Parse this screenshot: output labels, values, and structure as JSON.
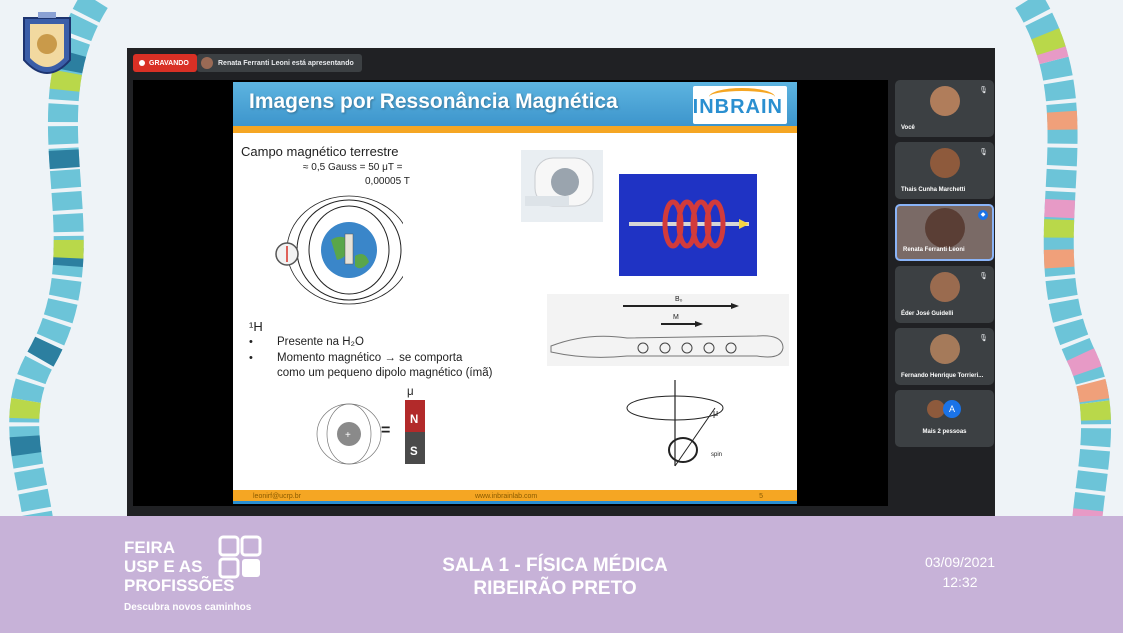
{
  "meeting": {
    "recording_label": "GRAVANDO",
    "presenting_text": "Renata Ferranti Leoni está apresentando"
  },
  "slide": {
    "title": "Imagens por Ressonância Magnética",
    "logo": "INBRAIN",
    "campo_title": "Campo magnético terrestre",
    "campo_value_1": "≈ 0,5 Gauss = 50 μT =",
    "campo_value_2": "0,00005 T",
    "h_label": "¹H",
    "bullet_1": "Presente na H₂O",
    "bullet_2_line1": "Momento magnético  →  se  comporta",
    "bullet_2_line2": "como um pequeno dipolo magnético (ímã)",
    "equals": "=",
    "magnet_n": "N",
    "magnet_s": "S",
    "mu": "μ",
    "b0": "B₀",
    "m": "M",
    "spin": "spin",
    "footer_email": "leonirf@ucrp.br",
    "footer_site": "www.inbrainlab.com",
    "page_number": "5"
  },
  "participants": [
    {
      "name": "Você"
    },
    {
      "name": "Thais Cunha Marchetti"
    },
    {
      "name": "Renata Ferranti Leoni"
    },
    {
      "name": "Éder José Guidelli"
    },
    {
      "name": "Fernando Henrique Torrieri..."
    }
  ],
  "more_people": "Mais 2 pessoas",
  "more_avatar_letter": "A",
  "banner": {
    "feira_line1": "FEIRA",
    "feira_line2": "USP E AS",
    "feira_line3": "PROFISSÕES",
    "tagline": "Descubra novos caminhos",
    "room_line1": "SALA 1 - FÍSICA MÉDICA",
    "room_line2": "RIBEIRÃO PRETO",
    "date": "03/09/2021",
    "time": "12:32"
  },
  "colors": {
    "banner": "#c7b2d8",
    "slide_header": "#3d95cc",
    "slide_accent": "#f5a623",
    "recording": "#d93025"
  }
}
